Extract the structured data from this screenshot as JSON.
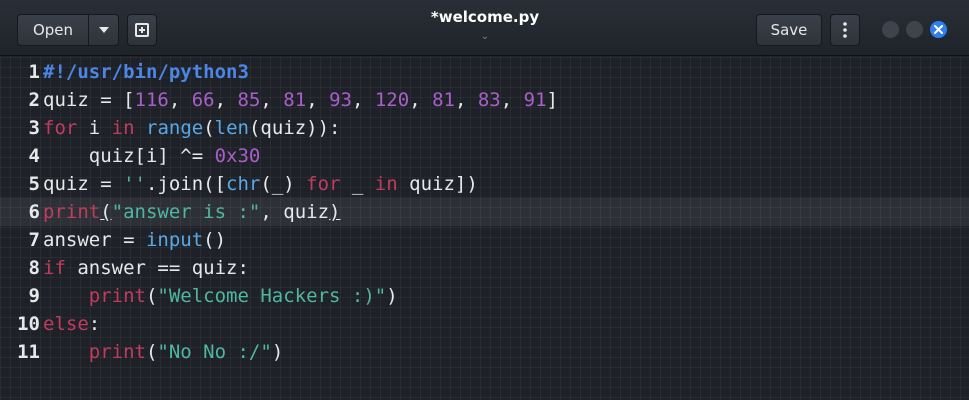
{
  "header": {
    "open_label": "Open",
    "save_label": "Save",
    "title": "*welcome.py",
    "title_chevron": "⌄"
  },
  "editor": {
    "current_line": 6,
    "lines": [
      {
        "number": "1",
        "tokens": [
          {
            "t": "#!/usr/bin/python3",
            "c": "shebang"
          }
        ]
      },
      {
        "number": "2",
        "tokens": [
          {
            "t": "quiz = [",
            "c": ""
          },
          {
            "t": "116",
            "c": "num"
          },
          {
            "t": ", ",
            "c": ""
          },
          {
            "t": "66",
            "c": "num"
          },
          {
            "t": ", ",
            "c": ""
          },
          {
            "t": "85",
            "c": "num"
          },
          {
            "t": ", ",
            "c": ""
          },
          {
            "t": "81",
            "c": "num"
          },
          {
            "t": ", ",
            "c": ""
          },
          {
            "t": "93",
            "c": "num"
          },
          {
            "t": ", ",
            "c": ""
          },
          {
            "t": "120",
            "c": "num"
          },
          {
            "t": ", ",
            "c": ""
          },
          {
            "t": "81",
            "c": "num"
          },
          {
            "t": ", ",
            "c": ""
          },
          {
            "t": "83",
            "c": "num"
          },
          {
            "t": ", ",
            "c": ""
          },
          {
            "t": "91",
            "c": "num"
          },
          {
            "t": "]",
            "c": ""
          }
        ]
      },
      {
        "number": "3",
        "tokens": [
          {
            "t": "for",
            "c": "kw"
          },
          {
            "t": " i ",
            "c": ""
          },
          {
            "t": "in",
            "c": "kw"
          },
          {
            "t": " ",
            "c": ""
          },
          {
            "t": "range",
            "c": "fn"
          },
          {
            "t": "(",
            "c": ""
          },
          {
            "t": "len",
            "c": "fn"
          },
          {
            "t": "(quiz)):",
            "c": ""
          }
        ]
      },
      {
        "number": "4",
        "tokens": [
          {
            "t": "    quiz[i] ^= ",
            "c": ""
          },
          {
            "t": "0x30",
            "c": "num"
          }
        ]
      },
      {
        "number": "5",
        "tokens": [
          {
            "t": "quiz = ",
            "c": ""
          },
          {
            "t": "''",
            "c": "str"
          },
          {
            "t": ".join([",
            "c": ""
          },
          {
            "t": "chr",
            "c": "fn"
          },
          {
            "t": "(_) ",
            "c": ""
          },
          {
            "t": "for",
            "c": "kw"
          },
          {
            "t": " _ ",
            "c": ""
          },
          {
            "t": "in",
            "c": "kw"
          },
          {
            "t": " quiz])",
            "c": ""
          }
        ]
      },
      {
        "number": "6",
        "tokens": [
          {
            "t": "print",
            "c": "kw"
          },
          {
            "t": "(",
            "c": "u"
          },
          {
            "t": "\"answer is :\"",
            "c": "str"
          },
          {
            "t": ", quiz",
            "c": ""
          },
          {
            "t": ")",
            "c": "u"
          }
        ]
      },
      {
        "number": "7",
        "tokens": [
          {
            "t": "answer = ",
            "c": ""
          },
          {
            "t": "input",
            "c": "fn"
          },
          {
            "t": "()",
            "c": ""
          }
        ]
      },
      {
        "number": "8",
        "tokens": [
          {
            "t": "if",
            "c": "kw"
          },
          {
            "t": " answer == quiz:",
            "c": ""
          }
        ]
      },
      {
        "number": "9",
        "tokens": [
          {
            "t": "    ",
            "c": ""
          },
          {
            "t": "print",
            "c": "kw"
          },
          {
            "t": "(",
            "c": ""
          },
          {
            "t": "\"Welcome Hackers :)\"",
            "c": "str"
          },
          {
            "t": ")",
            "c": ""
          }
        ]
      },
      {
        "number": "10",
        "tokens": [
          {
            "t": "else",
            "c": "kw"
          },
          {
            "t": ":",
            "c": ""
          }
        ]
      },
      {
        "number": "11",
        "tokens": [
          {
            "t": "    ",
            "c": ""
          },
          {
            "t": "print",
            "c": "kw"
          },
          {
            "t": "(",
            "c": ""
          },
          {
            "t": "\"No No :/\"",
            "c": "str"
          },
          {
            "t": ")",
            "c": ""
          }
        ]
      }
    ]
  },
  "colors": {
    "keyword": "#c23b5c",
    "number": "#a95ec9",
    "string": "#4fb6a3",
    "builtin": "#58a8e8",
    "shebang": "#4b86e8",
    "accent": "#2f7ff2"
  },
  "icons": {
    "open_dropdown": "chevron-down-icon",
    "new_tab": "new-document-icon",
    "menu": "vertical-dots-icon",
    "minimize": "minimize-icon",
    "maximize": "maximize-icon",
    "close": "close-icon"
  }
}
